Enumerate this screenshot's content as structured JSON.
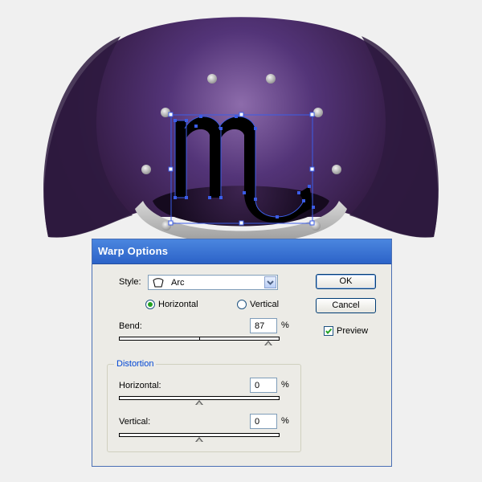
{
  "dialog": {
    "title": "Warp Options",
    "style_label": "Style:",
    "style_value": "Arc",
    "orientation_horizontal": "Horizontal",
    "orientation_vertical": "Vertical",
    "orientation_selected": "Horizontal",
    "bend_label": "Bend:",
    "bend_value": "87",
    "bend_unit": "%",
    "bend_level_percent": 87,
    "distortion_group_label": "Distortion",
    "horizontal_label": "Horizontal:",
    "horizontal_value": "0",
    "horizontal_unit": "%",
    "horizontal_level_percent": 0,
    "vertical_label": "Vertical:",
    "vertical_value": "0",
    "vertical_unit": "%",
    "vertical_level_percent": 0,
    "ok_label": "OK",
    "cancel_label": "Cancel",
    "preview_label": "Preview",
    "preview_checked": true
  },
  "artwork": {
    "glyph_description": "scorpio-sign-icon",
    "colors": {
      "background": "#f0f0f0",
      "dome_dark": "#2f1a46",
      "dome_light": "#7a5a98",
      "selection": "#3b5de7"
    }
  },
  "colors": {
    "titlebar": "#3f79d9",
    "dialog_bg": "#ecebe6",
    "group_label": "#0046d5"
  }
}
